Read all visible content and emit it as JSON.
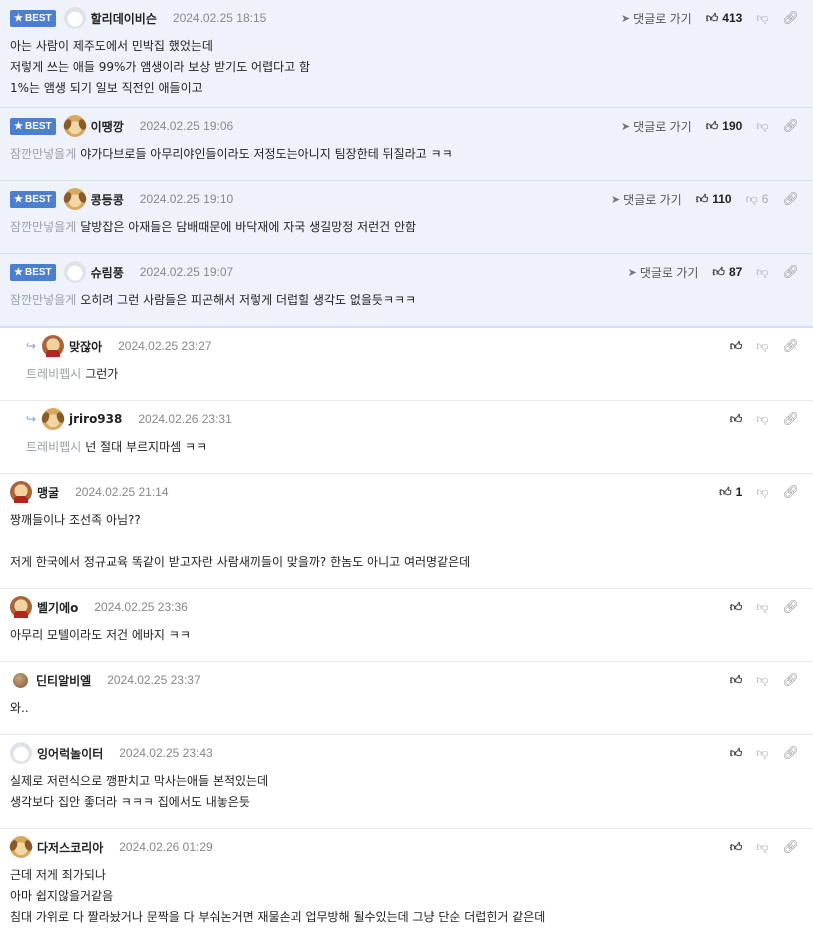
{
  "labels": {
    "best": "BEST",
    "goto": "댓글로 가기"
  },
  "comments": [
    {
      "nick": "할리데이비슨",
      "date": "2024.02.25 18:15",
      "likes": "413",
      "dislikes": "",
      "mention": "",
      "lines": [
        "아는 사람이 제주도에서 민박집 했었는데",
        "저렇게 쓰는 애들 99%가 앰생이라 보상 받기도 어렵다고 함",
        "1%는 앰생 되기 일보 직전인 애들이고"
      ]
    },
    {
      "nick": "이땡깡",
      "date": "2024.02.25 19:06",
      "likes": "190",
      "dislikes": "",
      "mention": "잠깐만넣을게",
      "lines": [
        "야가다브로들 아무리야인들이라도 저정도는아니지 팀장한테 뒤질라고 ㅋㅋ"
      ]
    },
    {
      "nick": "콩등콩",
      "date": "2024.02.25 19:10",
      "likes": "110",
      "dislikes": "6",
      "mention": "잠깐만넣을게",
      "lines": [
        "달방잡은 아재들은 담배때문에 바닥재에 자국 생길망정 저런건 안함"
      ]
    },
    {
      "nick": "슈림풍",
      "date": "2024.02.25 19:07",
      "likes": "87",
      "dislikes": "",
      "mention": "잠깐만넣을게",
      "lines": [
        "오히려 그런 사람들은 피곤해서 저렇게 더럽힐 생각도 없을듯ㅋㅋㅋ"
      ]
    },
    {
      "nick": "맞잖아",
      "date": "2024.02.25 23:27",
      "likes": "",
      "dislikes": "",
      "mention": "트레비펩시",
      "lines": [
        "그런가"
      ]
    },
    {
      "nick": "jriro938",
      "date": "2024.02.26 23:31",
      "likes": "",
      "dislikes": "",
      "mention": "트레비펩시",
      "lines": [
        "넌 절대 부르지마셈 ㅋㅋ"
      ]
    },
    {
      "nick": "맹굴",
      "date": "2024.02.25 21:14",
      "likes": "1",
      "dislikes": "",
      "mention": "",
      "lines": [
        "짱깨들이나 조선족 아님??",
        "",
        "저게 한국에서 정규교육 똑같이 받고자란 사람새끼들이 맞을까? 한놈도 아니고 여러명같은데"
      ]
    },
    {
      "nick": "벨기에o",
      "date": "2024.02.25 23:36",
      "likes": "",
      "dislikes": "",
      "mention": "",
      "lines": [
        "아무리 모텔이라도 저건 에바지 ㅋㅋ"
      ]
    },
    {
      "nick": "딘티알비엘",
      "date": "2024.02.25 23:37",
      "likes": "",
      "dislikes": "",
      "mention": "",
      "lines": [
        "와.."
      ]
    },
    {
      "nick": "잉어럭놀이터",
      "date": "2024.02.25 23:43",
      "likes": "",
      "dislikes": "",
      "mention": "",
      "lines": [
        "실제로 저런식으로 깽판치고 막사는애들 본적있는데",
        "생각보다 집안 좋더라 ㅋㅋㅋ 집에서도 내놓은듯"
      ]
    },
    {
      "nick": "다저스코리아",
      "date": "2024.02.26 01:29",
      "likes": "",
      "dislikes": "",
      "mention": "",
      "lines": [
        "근데 저게 죄가되나",
        "아마 쉽지않을거같음",
        "침대 가위로 다 짤라놨거나 문짝을 다 부숴논거면 재물손괴 업무방해 될수있는데 그냥 단순 더럽힌거 같은데"
      ]
    }
  ]
}
